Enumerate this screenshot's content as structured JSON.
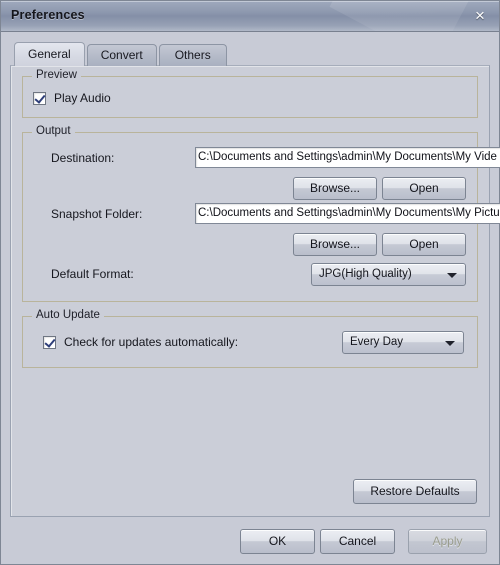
{
  "window": {
    "title": "Preferences",
    "close_icon": "close-icon",
    "close_glyph": "×"
  },
  "tabs": [
    {
      "label": "General",
      "active": true
    },
    {
      "label": "Convert",
      "active": false
    },
    {
      "label": "Others",
      "active": false
    }
  ],
  "general": {
    "preview": {
      "title": "Preview",
      "play_audio": {
        "label": "Play Audio",
        "checked": true
      }
    },
    "output": {
      "title": "Output",
      "destination": {
        "label": "Destination:",
        "value": "C:\\Documents and Settings\\admin\\My Documents\\My Vide",
        "browse_label": "Browse...",
        "open_label": "Open"
      },
      "snapshot": {
        "label": "Snapshot Folder:",
        "value": "C:\\Documents and Settings\\admin\\My Documents\\My Pictu",
        "browse_label": "Browse...",
        "open_label": "Open"
      },
      "default_format": {
        "label": "Default Format:",
        "value": "JPG(High Quality)",
        "arrow_icon": "chevron-down-icon"
      }
    },
    "auto_update": {
      "title": "Auto Update",
      "check_updates": {
        "label": "Check for updates automatically:",
        "checked": true
      },
      "frequency": {
        "value": "Every Day",
        "arrow_icon": "chevron-down-icon"
      }
    },
    "restore_defaults_label": "Restore Defaults"
  },
  "footer": {
    "ok_label": "OK",
    "cancel_label": "Cancel",
    "apply_label": "Apply",
    "apply_enabled": false
  },
  "colors": {
    "dialog_bg": "#c8cbd6",
    "panel_bg": "#cbced8",
    "titlebar_top": "#9fa9bd",
    "titlebar_bottom": "#b0b8c8",
    "group_border": "#b9b49b",
    "text": "#16171e",
    "disabled_text": "#9a9d8e",
    "input_bg": "#ffffff"
  }
}
